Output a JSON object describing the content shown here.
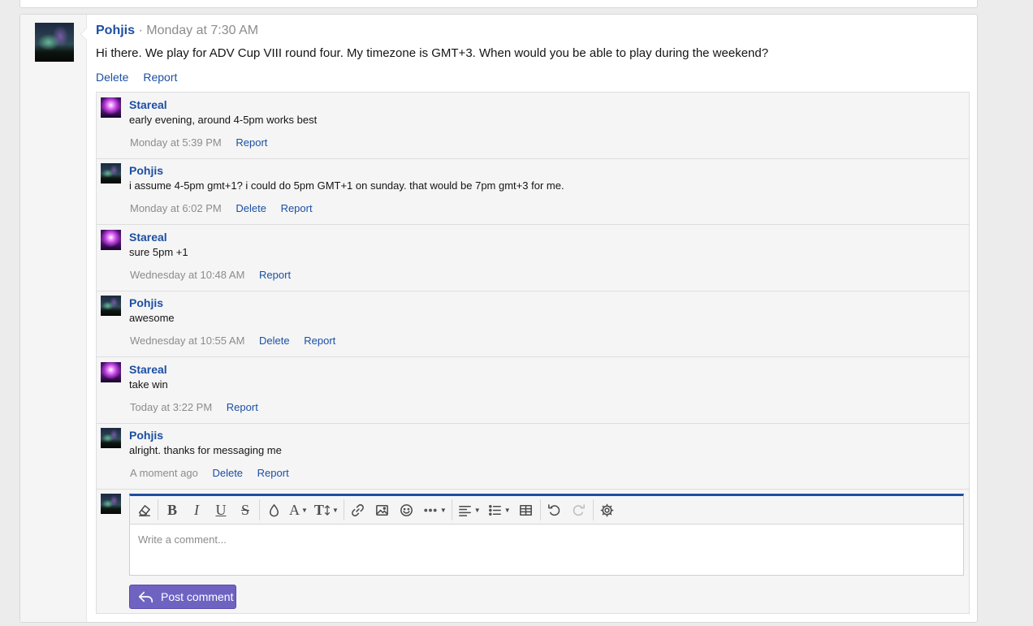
{
  "post": {
    "author": "Pohjis",
    "separator": "·",
    "timestamp": "Monday at 7:30 AM",
    "text": "Hi there. We play for ADV Cup VIII round four. My timezone is GMT+3. When would you be able to play during the weekend?",
    "actions": {
      "delete": "Delete",
      "report": "Report"
    }
  },
  "comments": [
    {
      "author": "Stareal",
      "text": "early evening, around 4-5pm works best",
      "time": "Monday at 5:39 PM",
      "report": "Report"
    },
    {
      "author": "Pohjis",
      "text": "i assume 4-5pm gmt+1? i could do 5pm GMT+1 on sunday. that would be 7pm gmt+3 for me.",
      "time": "Monday at 6:02 PM",
      "delete": "Delete",
      "report": "Report"
    },
    {
      "author": "Stareal",
      "text": "sure 5pm +1",
      "time": "Wednesday at 10:48 AM",
      "report": "Report"
    },
    {
      "author": "Pohjis",
      "text": "awesome",
      "time": "Wednesday at 10:55 AM",
      "delete": "Delete",
      "report": "Report"
    },
    {
      "author": "Stareal",
      "text": "take win",
      "time": "Today at 3:22 PM",
      "report": "Report"
    },
    {
      "author": "Pohjis",
      "text": "alright. thanks for messaging me",
      "time": "A moment ago",
      "delete": "Delete",
      "report": "Report"
    }
  ],
  "editor": {
    "placeholder": "Write a comment...",
    "toolbar_icons": [
      "eraser-icon",
      "bold-icon",
      "italic-icon",
      "underline-icon",
      "strikethrough-icon",
      "text-color-icon",
      "font-family-icon",
      "font-size-icon",
      "link-icon",
      "image-icon",
      "smilie-icon",
      "more-options-icon",
      "align-icon",
      "list-icon",
      "table-icon",
      "undo-icon",
      "redo-icon",
      "settings-icon"
    ],
    "bold": "B",
    "italic": "I",
    "underline": "U",
    "strike": "S",
    "font": "A",
    "font_size": "T"
  },
  "post_button": {
    "label": "Post comment"
  },
  "colors": {
    "link": "#1c4fa3",
    "button": "#6f63c2",
    "editor_accent": "#1c4fa3"
  }
}
